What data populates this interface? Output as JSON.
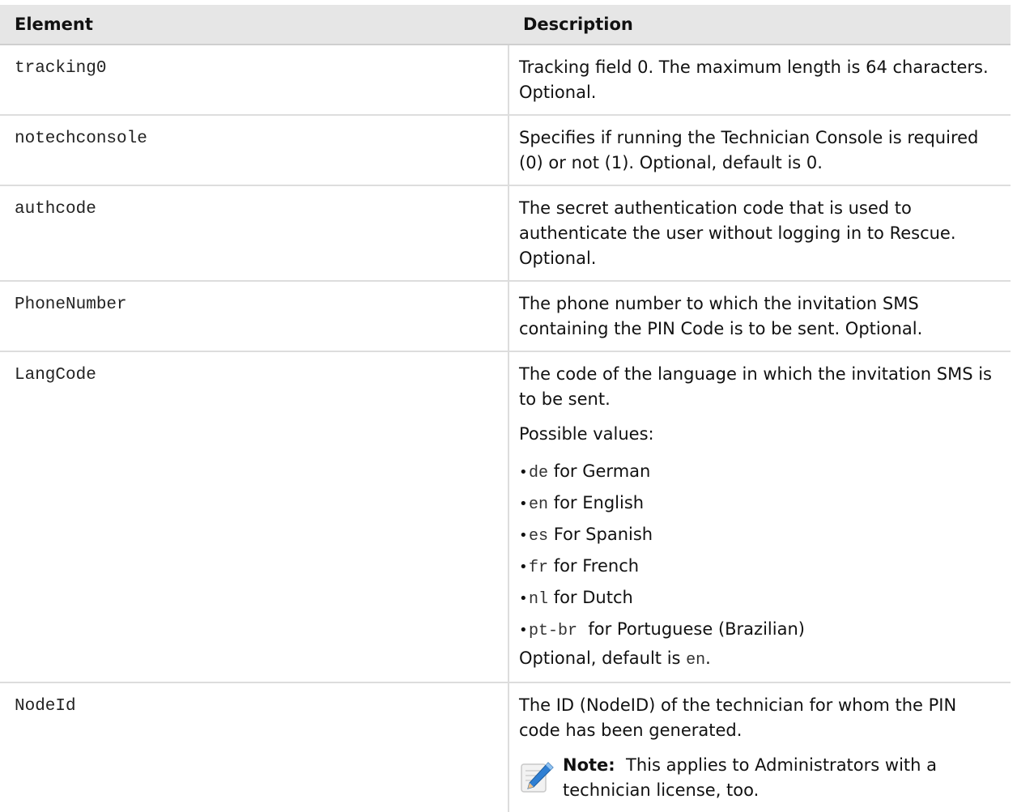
{
  "table": {
    "headers": {
      "element": "Element",
      "description": "Description"
    },
    "rows": [
      {
        "element": "tracking0",
        "description": "Tracking field 0. The maximum length is 64 characters. Optional."
      },
      {
        "element": "notechconsole",
        "description": "Specifies if running the Technician Console is required (0) or not (1). Optional, default is 0."
      },
      {
        "element": "authcode",
        "description": "The secret authentication code that is used to authenticate the user without logging in to Rescue. Optional."
      },
      {
        "element": "PhoneNumber",
        "description": "The phone number to which the invitation SMS containing the PIN Code is to be sent. Optional."
      },
      {
        "element": "LangCode",
        "description": "The code of the language in which the invitation SMS is to be sent.",
        "possible_values_label": "Possible values:",
        "values": [
          {
            "code": "de",
            "text": " for German"
          },
          {
            "code": "en",
            "text": " for English"
          },
          {
            "code": "es",
            "text": " For Spanish"
          },
          {
            "code": "fr",
            "text": " for French"
          },
          {
            "code": "nl",
            "text": " for Dutch"
          },
          {
            "code": "pt-br",
            "text": "  for Portuguese (Brazilian)"
          }
        ],
        "default_prefix": "Optional, default is ",
        "default_code": "en",
        "default_suffix": "."
      },
      {
        "element": "NodeId",
        "description": "The ID (NodeID) of the technician for whom the PIN code has been generated.",
        "note_label": "Note:",
        "note_text": "  This applies to Administrators with a technician license, too.",
        "note_icon": "pencil-note-icon"
      }
    ]
  }
}
